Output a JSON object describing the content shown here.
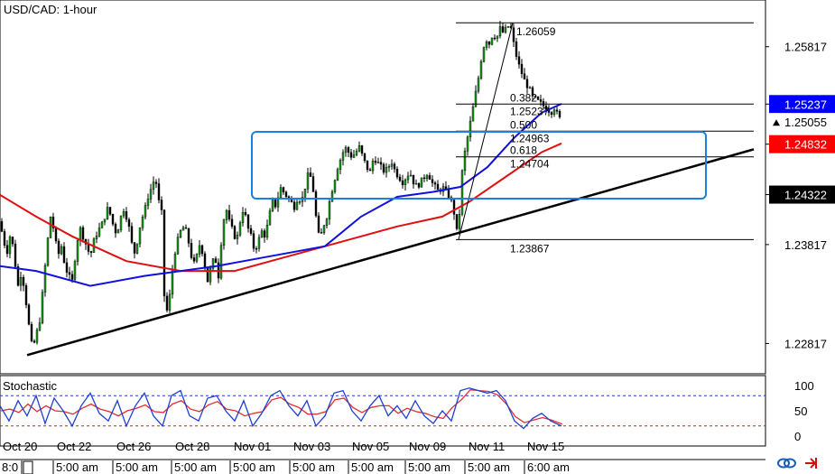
{
  "chart_data": {
    "type": "candlestick",
    "title": "USD/CAD: 1-hour",
    "price_axis": {
      "range": [
        1.2252,
        1.2628
      ],
      "ticks": [
        "1.25817",
        "1.25237",
        "1.24832",
        "1.24322",
        "1.23817",
        "1.22817"
      ],
      "current_price": "1.25055"
    },
    "badges": [
      {
        "label": "1.25237",
        "color": "#0000ff"
      },
      {
        "label": "1.24832",
        "color": "#ff0000"
      },
      {
        "label": "1.24322",
        "color": "#000000"
      }
    ],
    "date_labels": [
      "Oct 20",
      "Oct 22",
      "Oct 26",
      "Oct 28",
      "Nov 01",
      "Nov 03",
      "Nov 05",
      "Nov 09",
      "Nov 11",
      "Nov 15"
    ],
    "time_labels": [
      "8:0",
      "5:00 am",
      "5:00 am",
      "5:00 am",
      "5:00 am",
      "5:00 am",
      "5:00 am",
      "5:00 am",
      "5:00 am",
      "6:00 am"
    ],
    "price_path": [
      [
        0,
        1.2405
      ],
      [
        4,
        1.2385
      ],
      [
        8,
        1.2375
      ],
      [
        12,
        1.2395
      ],
      [
        16,
        1.2368
      ],
      [
        20,
        1.234
      ],
      [
        24,
        1.2355
      ],
      [
        28,
        1.233
      ],
      [
        32,
        1.23
      ],
      [
        36,
        1.2275
      ],
      [
        40,
        1.229
      ],
      [
        44,
        1.2305
      ],
      [
        48,
        1.234
      ],
      [
        52,
        1.238
      ],
      [
        56,
        1.241
      ],
      [
        60,
        1.2395
      ],
      [
        64,
        1.237
      ],
      [
        68,
        1.238
      ],
      [
        72,
        1.236
      ],
      [
        76,
        1.235
      ],
      [
        80,
        1.2345
      ],
      [
        84,
        1.2375
      ],
      [
        88,
        1.24
      ],
      [
        92,
        1.239
      ],
      [
        96,
        1.238
      ],
      [
        100,
        1.237
      ],
      [
        104,
        1.2385
      ],
      [
        108,
        1.2395
      ],
      [
        112,
        1.24
      ],
      [
        116,
        1.241
      ],
      [
        120,
        1.242
      ],
      [
        124,
        1.2405
      ],
      [
        128,
        1.2395
      ],
      [
        132,
        1.24
      ],
      [
        136,
        1.242
      ],
      [
        140,
        1.241
      ],
      [
        144,
        1.2395
      ],
      [
        148,
        1.237
      ],
      [
        152,
        1.2385
      ],
      [
        156,
        1.2405
      ],
      [
        160,
        1.2415
      ],
      [
        164,
        1.243
      ],
      [
        168,
        1.244
      ],
      [
        172,
        1.245
      ],
      [
        176,
        1.2425
      ],
      [
        180,
        1.241
      ],
      [
        182,
        1.233
      ],
      [
        186,
        1.231
      ],
      [
        190,
        1.235
      ],
      [
        194,
        1.2375
      ],
      [
        198,
        1.239
      ],
      [
        202,
        1.24
      ],
      [
        206,
        1.2395
      ],
      [
        210,
        1.238
      ],
      [
        214,
        1.236
      ],
      [
        218,
        1.237
      ],
      [
        222,
        1.2385
      ],
      [
        226,
        1.2365
      ],
      [
        230,
        1.2345
      ],
      [
        234,
        1.236
      ],
      [
        238,
        1.237
      ],
      [
        242,
        1.235
      ],
      [
        246,
        1.2395
      ],
      [
        250,
        1.242
      ],
      [
        254,
        1.2405
      ],
      [
        258,
        1.2395
      ],
      [
        262,
        1.2385
      ],
      [
        266,
        1.2405
      ],
      [
        270,
        1.242
      ],
      [
        274,
        1.24
      ],
      [
        278,
        1.239
      ],
      [
        282,
        1.2375
      ],
      [
        286,
        1.2385
      ],
      [
        290,
        1.2395
      ],
      [
        294,
        1.239
      ],
      [
        298,
        1.241
      ],
      [
        302,
        1.2425
      ],
      [
        306,
        1.242
      ],
      [
        310,
        1.244
      ],
      [
        314,
        1.2435
      ],
      [
        318,
        1.243
      ],
      [
        322,
        1.2425
      ],
      [
        326,
        1.242
      ],
      [
        330,
        1.243
      ],
      [
        334,
        1.2425
      ],
      [
        338,
        1.244
      ],
      [
        342,
        1.2455
      ],
      [
        346,
        1.2445
      ],
      [
        350,
        1.241
      ],
      [
        354,
        1.2385
      ],
      [
        358,
        1.24
      ],
      [
        362,
        1.241
      ],
      [
        366,
        1.243
      ],
      [
        370,
        1.2445
      ],
      [
        374,
        1.246
      ],
      [
        378,
        1.247
      ],
      [
        382,
        1.248
      ],
      [
        386,
        1.2475
      ],
      [
        390,
        1.247
      ],
      [
        394,
        1.2475
      ],
      [
        398,
        1.248
      ],
      [
        402,
        1.247
      ],
      [
        406,
        1.246
      ],
      [
        410,
        1.2455
      ],
      [
        414,
        1.247
      ],
      [
        418,
        1.2465
      ],
      [
        422,
        1.246
      ],
      [
        426,
        1.2455
      ],
      [
        430,
        1.246
      ],
      [
        434,
        1.2465
      ],
      [
        438,
        1.2455
      ],
      [
        442,
        1.245
      ],
      [
        446,
        1.2445
      ],
      [
        450,
        1.245
      ],
      [
        454,
        1.2455
      ],
      [
        458,
        1.2445
      ],
      [
        462,
        1.244
      ],
      [
        466,
        1.2445
      ],
      [
        470,
        1.245
      ],
      [
        474,
        1.2455
      ],
      [
        478,
        1.2445
      ],
      [
        482,
        1.244
      ],
      [
        486,
        1.2435
      ],
      [
        490,
        1.244
      ],
      [
        494,
        1.2435
      ],
      [
        498,
        1.243
      ],
      [
        502,
        1.242
      ],
      [
        506,
        1.2395
      ],
      [
        508,
        1.2387
      ],
      [
        510,
        1.244
      ],
      [
        514,
        1.247
      ],
      [
        518,
        1.249
      ],
      [
        522,
        1.251
      ],
      [
        526,
        1.253
      ],
      [
        530,
        1.255
      ],
      [
        534,
        1.2575
      ],
      [
        538,
        1.259
      ],
      [
        542,
        1.2585
      ],
      [
        546,
        1.2595
      ],
      [
        550,
        1.259
      ],
      [
        554,
        1.26
      ],
      [
        558,
        1.2595
      ],
      [
        562,
        1.2603
      ],
      [
        566,
        1.26
      ],
      [
        570,
        1.258
      ],
      [
        574,
        1.2565
      ],
      [
        578,
        1.2555
      ],
      [
        582,
        1.2545
      ],
      [
        586,
        1.254
      ],
      [
        590,
        1.253
      ],
      [
        594,
        1.2528
      ],
      [
        598,
        1.2525
      ],
      [
        602,
        1.2522
      ],
      [
        606,
        1.252
      ],
      [
        610,
        1.2515
      ],
      [
        614,
        1.252
      ],
      [
        618,
        1.2512
      ],
      [
        622,
        1.2506
      ]
    ],
    "ma_blue": [
      [
        0,
        1.236
      ],
      [
        40,
        1.2355
      ],
      [
        100,
        1.234
      ],
      [
        160,
        1.235
      ],
      [
        240,
        1.236
      ],
      [
        300,
        1.237
      ],
      [
        360,
        1.238
      ],
      [
        400,
        1.241
      ],
      [
        440,
        1.243
      ],
      [
        480,
        1.2435
      ],
      [
        510,
        1.244
      ],
      [
        540,
        1.246
      ],
      [
        570,
        1.249
      ],
      [
        600,
        1.2515
      ],
      [
        622,
        1.2524
      ]
    ],
    "ma_red": [
      [
        0,
        1.2432
      ],
      [
        40,
        1.241
      ],
      [
        80,
        1.239
      ],
      [
        140,
        1.2365
      ],
      [
        200,
        1.2355
      ],
      [
        260,
        1.2355
      ],
      [
        320,
        1.237
      ],
      [
        380,
        1.2385
      ],
      [
        440,
        1.24
      ],
      [
        490,
        1.241
      ],
      [
        520,
        1.2425
      ],
      [
        560,
        1.245
      ],
      [
        600,
        1.2475
      ],
      [
        622,
        1.2484
      ]
    ],
    "trendline": {
      "from": [
        30,
        1.227
      ],
      "to": [
        835,
        1.2478
      ]
    },
    "fib_levels": [
      {
        "level": "",
        "price": 1.26059,
        "label": "1.26059"
      },
      {
        "level": "0.382",
        "price": 1.25237,
        "label": "1.25237"
      },
      {
        "level": "0.500",
        "price": 1.24963,
        "label": "1.24963"
      },
      {
        "level": "0.618",
        "price": 1.24704,
        "label": "1.24704"
      },
      {
        "level": "",
        "price": 1.23867,
        "label": "1.23867"
      }
    ],
    "stochastic": {
      "label": "Stochastic",
      "ticks": [
        "100",
        "50",
        "0"
      ],
      "levels": [
        80,
        20
      ],
      "k": [
        [
          0,
          60
        ],
        [
          10,
          30
        ],
        [
          20,
          70
        ],
        [
          30,
          40
        ],
        [
          40,
          80
        ],
        [
          50,
          25
        ],
        [
          60,
          75
        ],
        [
          70,
          50
        ],
        [
          80,
          20
        ],
        [
          90,
          60
        ],
        [
          100,
          85
        ],
        [
          110,
          45
        ],
        [
          120,
          30
        ],
        [
          130,
          70
        ],
        [
          140,
          20
        ],
        [
          150,
          60
        ],
        [
          160,
          85
        ],
        [
          170,
          40
        ],
        [
          180,
          20
        ],
        [
          190,
          80
        ],
        [
          200,
          90
        ],
        [
          210,
          40
        ],
        [
          220,
          30
        ],
        [
          230,
          75
        ],
        [
          240,
          80
        ],
        [
          250,
          50
        ],
        [
          260,
          30
        ],
        [
          270,
          70
        ],
        [
          280,
          20
        ],
        [
          290,
          45
        ],
        [
          300,
          80
        ],
        [
          310,
          90
        ],
        [
          320,
          60
        ],
        [
          330,
          40
        ],
        [
          340,
          70
        ],
        [
          350,
          20
        ],
        [
          360,
          40
        ],
        [
          370,
          85
        ],
        [
          380,
          90
        ],
        [
          390,
          50
        ],
        [
          400,
          30
        ],
        [
          410,
          60
        ],
        [
          420,
          80
        ],
        [
          430,
          40
        ],
        [
          440,
          60
        ],
        [
          450,
          35
        ],
        [
          460,
          70
        ],
        [
          470,
          40
        ],
        [
          480,
          25
        ],
        [
          490,
          50
        ],
        [
          500,
          30
        ],
        [
          510,
          90
        ],
        [
          520,
          95
        ],
        [
          530,
          90
        ],
        [
          540,
          85
        ],
        [
          550,
          90
        ],
        [
          560,
          70
        ],
        [
          570,
          30
        ],
        [
          580,
          15
        ],
        [
          590,
          35
        ],
        [
          600,
          45
        ],
        [
          610,
          30
        ],
        [
          622,
          20
        ]
      ]
    }
  },
  "ui": {
    "icons": [
      "link-icon",
      "arrow-icon"
    ]
  }
}
